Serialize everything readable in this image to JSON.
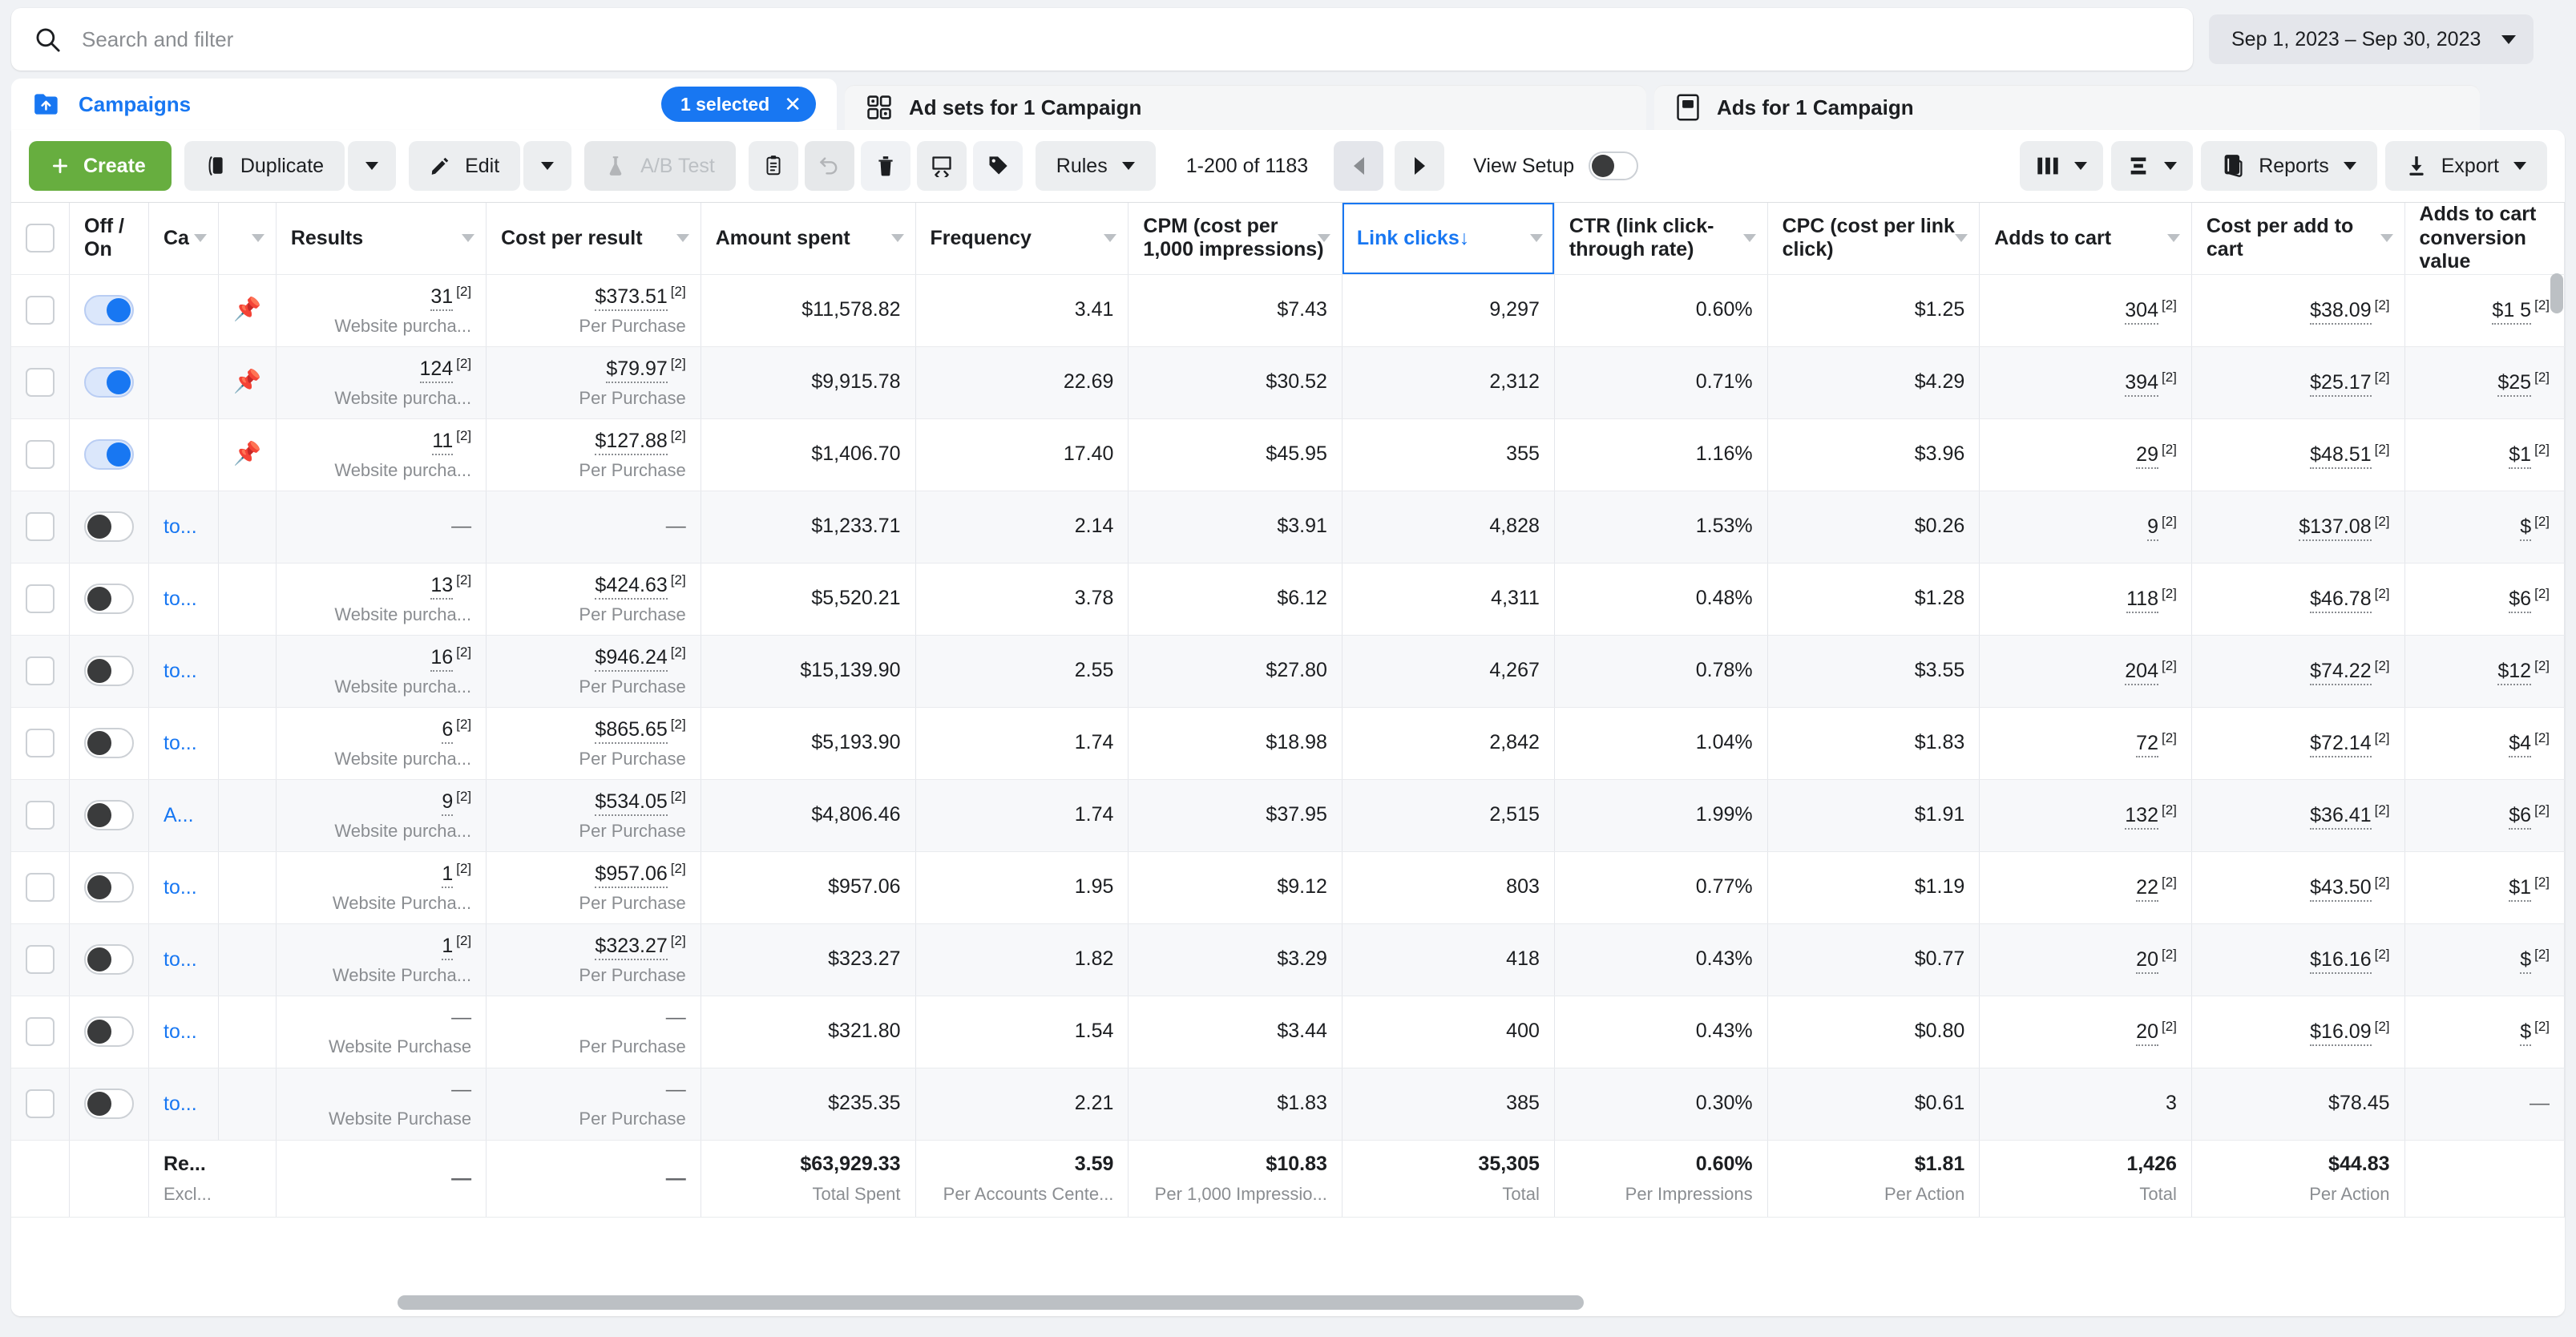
{
  "search": {
    "placeholder": "Search and filter",
    "value": "",
    "icon": "search-icon"
  },
  "date_range": {
    "label": "Sep 1, 2023 – Sep 30, 2023"
  },
  "tabs": [
    {
      "label": "Campaigns",
      "icon": "folder-icon",
      "active": true,
      "badge": "1 selected"
    },
    {
      "label": "Ad sets for 1 Campaign",
      "icon": "grid-icon",
      "active": false
    },
    {
      "label": "Ads for 1 Campaign",
      "icon": "document-icon",
      "active": false
    }
  ],
  "toolbar": {
    "create_label": "Create",
    "duplicate_label": "Duplicate",
    "edit_label": "Edit",
    "ab_test_label": "A/B Test",
    "rules_label": "Rules",
    "reports_label": "Reports",
    "export_label": "Export",
    "view_setup_label": "View Setup",
    "pagination_label": "1-200 of 1183",
    "icons": {
      "duplicate": "copy-icon",
      "edit": "pencil-icon",
      "ab_test": "flask-icon",
      "clipboard": "clipboard-icon",
      "undo": "undo-icon",
      "delete": "trash-icon",
      "review": "review-icon",
      "tag": "tag-icon",
      "columns": "columns-icon",
      "breakdown": "breakdown-icon",
      "reports": "reports-icon",
      "export": "download-icon"
    }
  },
  "table": {
    "columns": [
      {
        "key": "off_on",
        "label": "Off / On",
        "sorted": false
      },
      {
        "key": "campaign",
        "label": "Ca",
        "sorted": false
      },
      {
        "key": "results",
        "label": "Results",
        "sorted": false
      },
      {
        "key": "cost_per_result",
        "label": "Cost per result",
        "sorted": false
      },
      {
        "key": "amount_spent",
        "label": "Amount spent",
        "sorted": false
      },
      {
        "key": "frequency",
        "label": "Frequency",
        "sorted": false
      },
      {
        "key": "cpm",
        "label": "CPM (cost per 1,000 impressions)",
        "sorted": false
      },
      {
        "key": "link_clicks",
        "label": "Link clicks",
        "sorted": true,
        "sort_dir": "↓"
      },
      {
        "key": "ctr",
        "label": "CTR (link click-through rate)",
        "sorted": false
      },
      {
        "key": "cpc",
        "label": "CPC (cost per link click)",
        "sorted": false
      },
      {
        "key": "adds_to_cart",
        "label": "Adds to cart",
        "sorted": false
      },
      {
        "key": "cost_per_add_to_cart",
        "label": "Cost per add to cart",
        "sorted": false
      },
      {
        "key": "adds_to_cart_conv_value",
        "label": "Adds to cart conversion value",
        "sorted": false
      }
    ],
    "rows": [
      {
        "toggle": "on",
        "pinned": true,
        "campaign": "",
        "results": "31",
        "results_sup": "[2]",
        "results_sub": "Website purcha...",
        "cost_per_result": "$373.51",
        "cost_per_result_sup": "[2]",
        "cost_per_result_sub": "Per Purchase",
        "amount_spent": "$11,578.82",
        "frequency": "3.41",
        "cpm": "$7.43",
        "link_clicks": "9,297",
        "ctr": "0.60%",
        "cpc": "$1.25",
        "adds_to_cart": "304",
        "adds_to_cart_sup": "[2]",
        "cost_per_add_to_cart": "$38.09",
        "cost_per_add_to_cart_sup": "[2]",
        "adds_to_cart_conv_value": "$1 5"
      },
      {
        "toggle": "on",
        "pinned": true,
        "campaign": "",
        "results": "124",
        "results_sup": "[2]",
        "results_sub": "Website purcha...",
        "cost_per_result": "$79.97",
        "cost_per_result_sup": "[2]",
        "cost_per_result_sub": "Per Purchase",
        "amount_spent": "$9,915.78",
        "frequency": "22.69",
        "cpm": "$30.52",
        "link_clicks": "2,312",
        "ctr": "0.71%",
        "cpc": "$4.29",
        "adds_to_cart": "394",
        "adds_to_cart_sup": "[2]",
        "cost_per_add_to_cart": "$25.17",
        "cost_per_add_to_cart_sup": "[2]",
        "adds_to_cart_conv_value": "$25"
      },
      {
        "toggle": "on",
        "pinned": true,
        "campaign": "",
        "results": "11",
        "results_sup": "[2]",
        "results_sub": "Website purcha...",
        "cost_per_result": "$127.88",
        "cost_per_result_sup": "[2]",
        "cost_per_result_sub": "Per Purchase",
        "amount_spent": "$1,406.70",
        "frequency": "17.40",
        "cpm": "$45.95",
        "link_clicks": "355",
        "ctr": "1.16%",
        "cpc": "$3.96",
        "adds_to_cart": "29",
        "adds_to_cart_sup": "[2]",
        "cost_per_add_to_cart": "$48.51",
        "cost_per_add_to_cart_sup": "[2]",
        "adds_to_cart_conv_value": "$1"
      },
      {
        "toggle": "off",
        "pinned": false,
        "campaign": "to...",
        "results": "—",
        "results_sup": "",
        "results_sub": "",
        "cost_per_result": "—",
        "cost_per_result_sup": "",
        "cost_per_result_sub": "",
        "amount_spent": "$1,233.71",
        "frequency": "2.14",
        "cpm": "$3.91",
        "link_clicks": "4,828",
        "ctr": "1.53%",
        "cpc": "$0.26",
        "adds_to_cart": "9",
        "adds_to_cart_sup": "[2]",
        "cost_per_add_to_cart": "$137.08",
        "cost_per_add_to_cart_sup": "[2]",
        "adds_to_cart_conv_value": "$"
      },
      {
        "toggle": "off",
        "pinned": false,
        "campaign": "to...",
        "results": "13",
        "results_sup": "[2]",
        "results_sub": "Website purcha...",
        "cost_per_result": "$424.63",
        "cost_per_result_sup": "[2]",
        "cost_per_result_sub": "Per Purchase",
        "amount_spent": "$5,520.21",
        "frequency": "3.78",
        "cpm": "$6.12",
        "link_clicks": "4,311",
        "ctr": "0.48%",
        "cpc": "$1.28",
        "adds_to_cart": "118",
        "adds_to_cart_sup": "[2]",
        "cost_per_add_to_cart": "$46.78",
        "cost_per_add_to_cart_sup": "[2]",
        "adds_to_cart_conv_value": "$6"
      },
      {
        "toggle": "off",
        "pinned": false,
        "campaign": "to...",
        "results": "16",
        "results_sup": "[2]",
        "results_sub": "Website purcha...",
        "cost_per_result": "$946.24",
        "cost_per_result_sup": "[2]",
        "cost_per_result_sub": "Per Purchase",
        "amount_spent": "$15,139.90",
        "frequency": "2.55",
        "cpm": "$27.80",
        "link_clicks": "4,267",
        "ctr": "0.78%",
        "cpc": "$3.55",
        "adds_to_cart": "204",
        "adds_to_cart_sup": "[2]",
        "cost_per_add_to_cart": "$74.22",
        "cost_per_add_to_cart_sup": "[2]",
        "adds_to_cart_conv_value": "$12"
      },
      {
        "toggle": "off",
        "pinned": false,
        "campaign": "to...",
        "results": "6",
        "results_sup": "[2]",
        "results_sub": "Website purcha...",
        "cost_per_result": "$865.65",
        "cost_per_result_sup": "[2]",
        "cost_per_result_sub": "Per Purchase",
        "amount_spent": "$5,193.90",
        "frequency": "1.74",
        "cpm": "$18.98",
        "link_clicks": "2,842",
        "ctr": "1.04%",
        "cpc": "$1.83",
        "adds_to_cart": "72",
        "adds_to_cart_sup": "[2]",
        "cost_per_add_to_cart": "$72.14",
        "cost_per_add_to_cart_sup": "[2]",
        "adds_to_cart_conv_value": "$4"
      },
      {
        "toggle": "off",
        "pinned": false,
        "campaign": "A...",
        "results": "9",
        "results_sup": "[2]",
        "results_sub": "Website purcha...",
        "cost_per_result": "$534.05",
        "cost_per_result_sup": "[2]",
        "cost_per_result_sub": "Per Purchase",
        "amount_spent": "$4,806.46",
        "frequency": "1.74",
        "cpm": "$37.95",
        "link_clicks": "2,515",
        "ctr": "1.99%",
        "cpc": "$1.91",
        "adds_to_cart": "132",
        "adds_to_cart_sup": "[2]",
        "cost_per_add_to_cart": "$36.41",
        "cost_per_add_to_cart_sup": "[2]",
        "adds_to_cart_conv_value": "$6"
      },
      {
        "toggle": "off",
        "pinned": false,
        "campaign": "to...",
        "results": "1",
        "results_sup": "[2]",
        "results_sub": "Website Purcha...",
        "cost_per_result": "$957.06",
        "cost_per_result_sup": "[2]",
        "cost_per_result_sub": "Per Purchase",
        "amount_spent": "$957.06",
        "frequency": "1.95",
        "cpm": "$9.12",
        "link_clicks": "803",
        "ctr": "0.77%",
        "cpc": "$1.19",
        "adds_to_cart": "22",
        "adds_to_cart_sup": "[2]",
        "cost_per_add_to_cart": "$43.50",
        "cost_per_add_to_cart_sup": "[2]",
        "adds_to_cart_conv_value": "$1"
      },
      {
        "toggle": "off",
        "pinned": false,
        "campaign": "to...",
        "results": "1",
        "results_sup": "[2]",
        "results_sub": "Website Purcha...",
        "cost_per_result": "$323.27",
        "cost_per_result_sup": "[2]",
        "cost_per_result_sub": "Per Purchase",
        "amount_spent": "$323.27",
        "frequency": "1.82",
        "cpm": "$3.29",
        "link_clicks": "418",
        "ctr": "0.43%",
        "cpc": "$0.77",
        "adds_to_cart": "20",
        "adds_to_cart_sup": "[2]",
        "cost_per_add_to_cart": "$16.16",
        "cost_per_add_to_cart_sup": "[2]",
        "adds_to_cart_conv_value": "$"
      },
      {
        "toggle": "off",
        "pinned": false,
        "campaign": "to...",
        "results": "—",
        "results_sup": "",
        "results_sub": "Website Purchase",
        "cost_per_result": "—",
        "cost_per_result_sup": "",
        "cost_per_result_sub": "Per Purchase",
        "amount_spent": "$321.80",
        "frequency": "1.54",
        "cpm": "$3.44",
        "link_clicks": "400",
        "ctr": "0.43%",
        "cpc": "$0.80",
        "adds_to_cart": "20",
        "adds_to_cart_sup": "[2]",
        "cost_per_add_to_cart": "$16.09",
        "cost_per_add_to_cart_sup": "[2]",
        "adds_to_cart_conv_value": "$"
      },
      {
        "toggle": "off",
        "pinned": false,
        "campaign": "to...",
        "results": "—",
        "results_sup": "",
        "results_sub": "Website Purchase",
        "cost_per_result": "—",
        "cost_per_result_sup": "",
        "cost_per_result_sub": "Per Purchase",
        "amount_spent": "$235.35",
        "frequency": "2.21",
        "cpm": "$1.83",
        "link_clicks": "385",
        "ctr": "0.30%",
        "cpc": "$0.61",
        "adds_to_cart": "3",
        "adds_to_cart_sup": "",
        "cost_per_add_to_cart": "$78.45",
        "cost_per_add_to_cart_sup": "",
        "adds_to_cart_conv_value": ""
      }
    ],
    "footer": {
      "label_main": "Re...",
      "label_sub": "Excl...",
      "results": "—",
      "cost_per_result": "—",
      "amount_spent": "$63,929.33",
      "amount_spent_sub": "Total Spent",
      "frequency": "3.59",
      "frequency_sub": "Per Accounts Cente...",
      "cpm": "$10.83",
      "cpm_sub": "Per 1,000 Impressio...",
      "link_clicks": "35,305",
      "link_clicks_sub": "Total",
      "ctr": "0.60%",
      "ctr_sub": "Per Impressions",
      "cpc": "$1.81",
      "cpc_sub": "Per Action",
      "adds_to_cart": "1,426",
      "adds_to_cart_sub": "Total",
      "cost_per_add_to_cart": "$44.83",
      "cost_per_add_to_cart_sub": "Per Action",
      "adds_to_cart_conv_value": "",
      "adds_to_cart_conv_value_sub": ""
    }
  },
  "colors": {
    "accent": "#1877f2",
    "create_green": "#67ae3f",
    "page_bg": "#f0f2f5",
    "panel_bg": "#ffffff",
    "muted_text": "#8a8d91"
  }
}
